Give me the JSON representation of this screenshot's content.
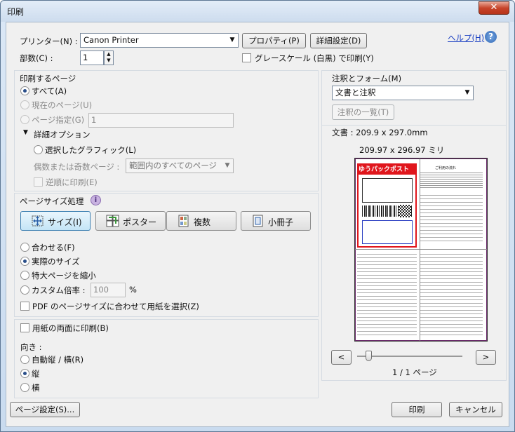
{
  "window": {
    "title": "印刷",
    "close_symbol": "✕"
  },
  "printer": {
    "label": "プリンター(N) :",
    "selected": "Canon Printer",
    "properties_button": "プロパティ(P)",
    "advanced_button": "詳細設定(D)",
    "help_link": "ヘルプ(H)",
    "copies_label": "部数(C) :",
    "copies_value": "1",
    "grayscale_label": "グレースケール (白黒) で印刷(Y)"
  },
  "pages": {
    "group_title": "印刷するページ",
    "all": "すべて(A)",
    "current": "現在のページ(U)",
    "range": "ページ指定(G)",
    "range_value": "1",
    "more_options": "詳細オプション",
    "selected_graphics": "選択したグラフィック(L)",
    "odd_even_label": "偶数または奇数ページ :",
    "odd_even_value": "範囲内のすべてのページ",
    "reverse": "逆順に印刷(E)"
  },
  "sizing": {
    "group_title": "ページサイズ処理",
    "info_symbol": "i",
    "size_button": "サイズ(I)",
    "poster_button": "ポスター",
    "multiple_button": "複数",
    "booklet_button": "小冊子",
    "fit": "合わせる(F)",
    "actual": "実際のサイズ",
    "shrink": "特大ページを縮小",
    "custom": "カスタム倍率 :",
    "custom_value": "100",
    "percent": "%",
    "choose_paper": "PDF のページサイズに合わせて用紙を選択(Z)"
  },
  "duplex": {
    "both_sides": "用紙の両面に印刷(B)",
    "orientation_label": "向き :",
    "auto": "自動縦 / 横(R)",
    "portrait": "縦",
    "landscape": "横"
  },
  "comments": {
    "group_title": "注釈とフォーム(M)",
    "selected": "文書と注釈",
    "summarize_button": "注釈の一覧(T)"
  },
  "preview": {
    "doc_size": "文書 : 209.9 x 297.0mm",
    "paper_size": "209.97 x 296.97 ミリ",
    "prev_button": "<",
    "next_button": ">",
    "page_indicator": "1 / 1 ページ",
    "page_logo_text": "ゆうパックポスト",
    "page_heading": "ご利用の流れ"
  },
  "footer": {
    "page_setup": "ページ設定(S)...",
    "print": "印刷",
    "cancel": "キャンセル"
  },
  "colors": {
    "accent": "#2a4f8a",
    "link": "#1a3fc2",
    "logo_red": "#e0161c"
  }
}
